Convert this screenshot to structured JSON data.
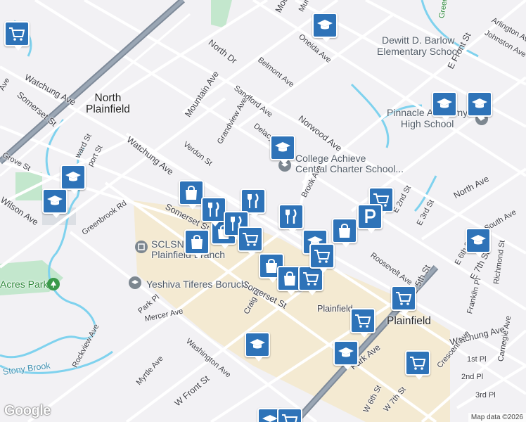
{
  "map": {
    "attribution": "Map data ©2026",
    "logo": "Google",
    "colors": {
      "background": "#f2f1f4",
      "road": "#ffffff",
      "highway": "#7e8a99",
      "water": "#7fd2ee",
      "park": "#c3e7cd",
      "downtown": "#f4e9c9",
      "marker": "#2e73b8"
    }
  },
  "place_labels": [
    "North Plainfield",
    "Plainfield",
    "Dewitt D. Barlow Elementary School",
    "Pinnacle Academy High School",
    "College Achieve Central Charter School...",
    "SCLSNJ - Plainfield Branch",
    "Yeshiva Tiferes Boruch",
    "Acres Park",
    "Stony Brook",
    "Greenbrook Rd"
  ],
  "street_labels": [
    "Mountain Ave",
    "North Dr",
    "Muriel Ave",
    "Oneida Ave",
    "Belmont Ave",
    "Watchung Ave",
    "Somerset St",
    "Sandford Ave",
    "Norwood Ave",
    "Delacy Ave",
    "Grandview Ave",
    "Verdon St",
    "Grove St",
    "Wilson Ave",
    "Brook Ave",
    "North Ave",
    "E 2nd St",
    "E 3rd St",
    "Roosevelt Ave",
    "Johnston Ave",
    "E Front St",
    "E 5th St",
    "E 6th St",
    "E 7th St",
    "Richmond St",
    "Franklin Pl",
    "Crescent Ave",
    "Carnegie Ave",
    "Park Pl",
    "Mercer Ave",
    "Craig Pl",
    "Washington Ave",
    "Rockview Ave",
    "Myrtle Ave",
    "W Front St",
    "Park Ave",
    "W 6th St",
    "W 7th St",
    "1st Pl",
    "2nd Pl",
    "3rd Pl",
    "South Ave",
    "Arlington Ave",
    "Greenbrook Rd",
    "Green"
  ],
  "labels": {
    "north_plainfield": "North\nPlainfield",
    "plainfield": "Plainfield",
    "plainfield_station": "Plainfield",
    "dewitt": "Dewitt D. Barlow\nElementary School",
    "pinnacle": "Pinnacle Academy\nHigh School",
    "college": "College Achieve\nCentral Charter School...",
    "sclsnj": "SCLSNJ -\nPlainfield Branch",
    "yeshiva": "Yeshiva Tiferes Boruch",
    "acres": "Acres Park",
    "stony": "Stony Brook",
    "mountain1": "Mountain Ave",
    "mountain2": "Mountain Ave",
    "north_dr": "North Dr",
    "muriel": "Muriel Ave",
    "oneida": "Oneida Ave",
    "belmont": "Belmont Ave",
    "watchung1": "Watchung Ave",
    "watchung2": "Watchung Ave",
    "watchung3": "Watchung Ave",
    "somerset1": "Somerset St",
    "somerset2": "Somerset St",
    "somerset3": "Somerset St",
    "sandford": "Sandford Ave",
    "norwood": "Norwood Ave",
    "delacy": "Delacy Ave",
    "grandview": "Grandview Ave",
    "verdon": "Verdon St",
    "grove": "Grove St",
    "wilson": "Wilson Ave",
    "brook": "Brook Ave",
    "north_ave": "North Ave",
    "e2nd": "E 2nd St",
    "e3rd": "E 3rd St",
    "roosevelt": "Roosevelt Ave",
    "johnston": "Johnston Ave",
    "e_front": "E Front St",
    "e5th": "E 5th St",
    "e6th": "E 6th St",
    "e7th": "E 7th St",
    "richmond": "Richmond St",
    "franklin": "Franklin Pl",
    "crescent": "Crescent Ave",
    "carnegie": "Carnegie Ave",
    "park_pl": "Park Pl",
    "mercer": "Mercer Ave",
    "craig": "Craig Pl",
    "washington": "Washington Ave",
    "rockview": "Rockview Ave",
    "myrtle": "Myrtle Ave",
    "w_front": "W Front St",
    "park_ave": "Park Ave",
    "w6th": "W 6th St",
    "w7th": "W 7th St",
    "pl1": "1st Pl",
    "pl2": "2nd Pl",
    "pl3": "3rd Pl",
    "south_ave": "South Ave",
    "arlington": "Arlington Ave",
    "greenbrook": "Greenbrook Rd",
    "green": "Green",
    "ward": "ward St",
    "port": "port St",
    "ave_tl": "Ave"
  }
}
